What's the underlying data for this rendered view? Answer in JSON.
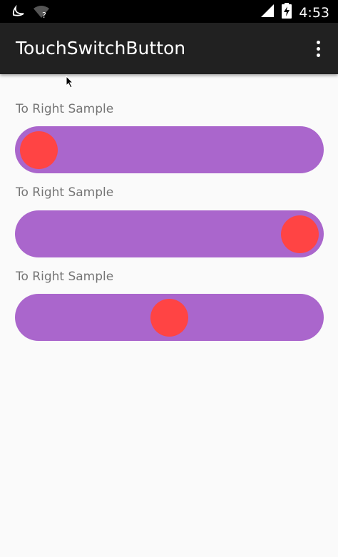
{
  "status_bar": {
    "time": "4:53",
    "icons": [
      "notification-icon",
      "wifi-unknown-icon",
      "signal-icon",
      "battery-charging-icon"
    ]
  },
  "app_bar": {
    "title": "TouchSwitchButton",
    "overflow_icon": "more-vert-icon"
  },
  "colors": {
    "track": "#aa66cc",
    "thumb": "#ff4444",
    "app_bar": "#212121",
    "label": "#757575"
  },
  "switches": [
    {
      "label": "To Right Sample",
      "progress": 0.0
    },
    {
      "label": "To Right Sample",
      "progress": 1.0
    },
    {
      "label": "To Right Sample",
      "progress": 0.5
    }
  ]
}
